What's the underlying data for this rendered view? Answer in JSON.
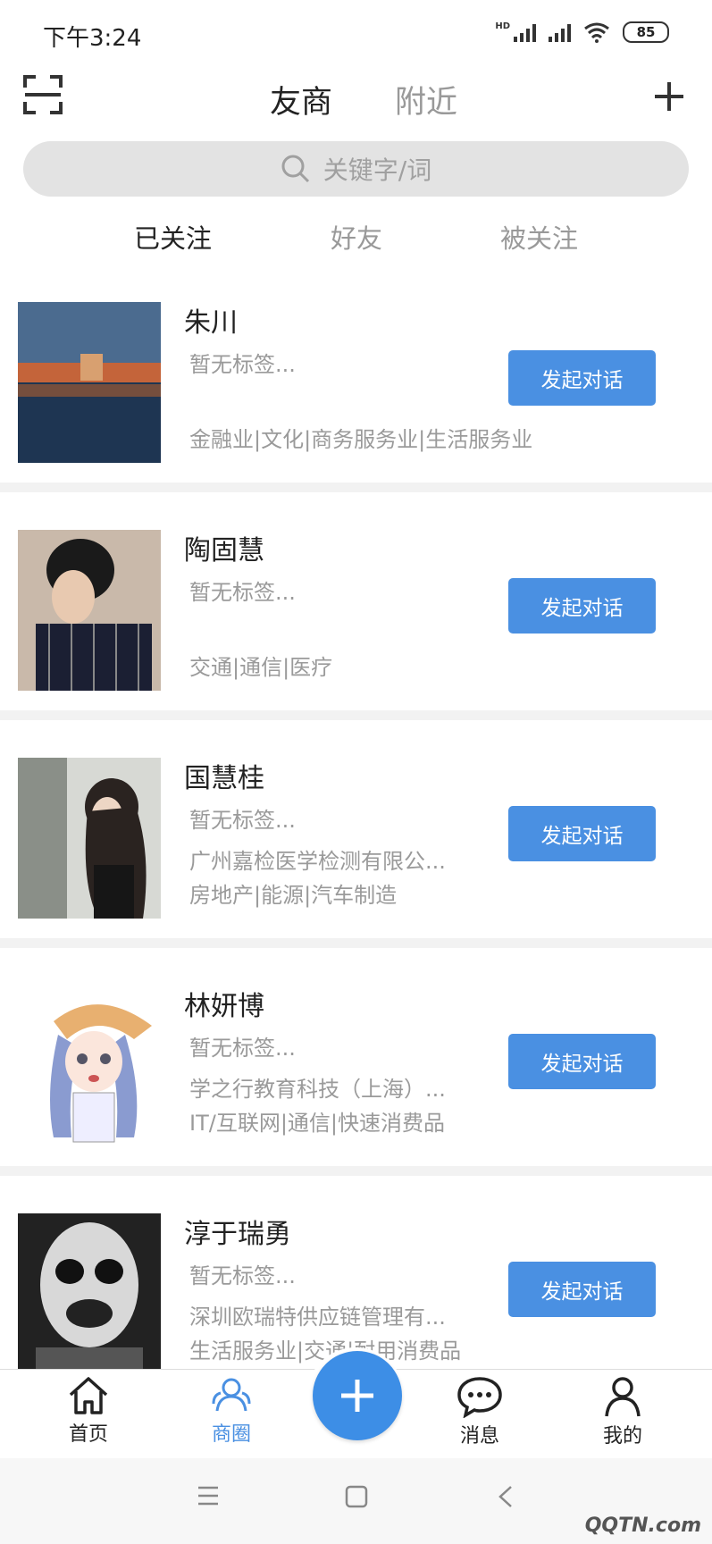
{
  "status_bar": {
    "time": "下午3:24",
    "hd": "HD",
    "battery": "85"
  },
  "header": {
    "tabs": [
      "友商",
      "附近"
    ],
    "search_placeholder": "关键字/词",
    "sub_tabs": [
      "已关注",
      "好友",
      "被关注"
    ]
  },
  "contacts": [
    {
      "name": "朱川",
      "tag": "暂无标签...",
      "company": "",
      "industries": "金融业|文化|商务服务业|生活服务业",
      "button": "发起对话"
    },
    {
      "name": "陶固慧",
      "tag": "暂无标签...",
      "company": "",
      "industries": "交通|通信|医疗",
      "button": "发起对话"
    },
    {
      "name": "国慧桂",
      "tag": "暂无标签...",
      "company": "广州嘉检医学检测有限公...",
      "industries": "房地产|能源|汽车制造",
      "button": "发起对话"
    },
    {
      "name": "林妍博",
      "tag": "暂无标签...",
      "company": "学之行教育科技（上海）...",
      "industries": "IT/互联网|通信|快速消费品",
      "button": "发起对话"
    },
    {
      "name": "淳于瑞勇",
      "tag": "暂无标签...",
      "company": "深圳欧瑞特供应链管理有...",
      "industries": "生活服务业|交通|耐用消费品",
      "button": "发起对话"
    }
  ],
  "bottom_nav": [
    {
      "label": "首页",
      "icon": "home-icon"
    },
    {
      "label": "商圈",
      "icon": "people-icon",
      "active": true
    },
    {
      "label": "",
      "icon": "plus-icon"
    },
    {
      "label": "消息",
      "icon": "chat-bubble-icon"
    },
    {
      "label": "我的",
      "icon": "person-icon"
    }
  ],
  "watermark": "QQTN.com",
  "colors": {
    "accent": "#4a90e2",
    "fab": "#3d8ee6"
  }
}
